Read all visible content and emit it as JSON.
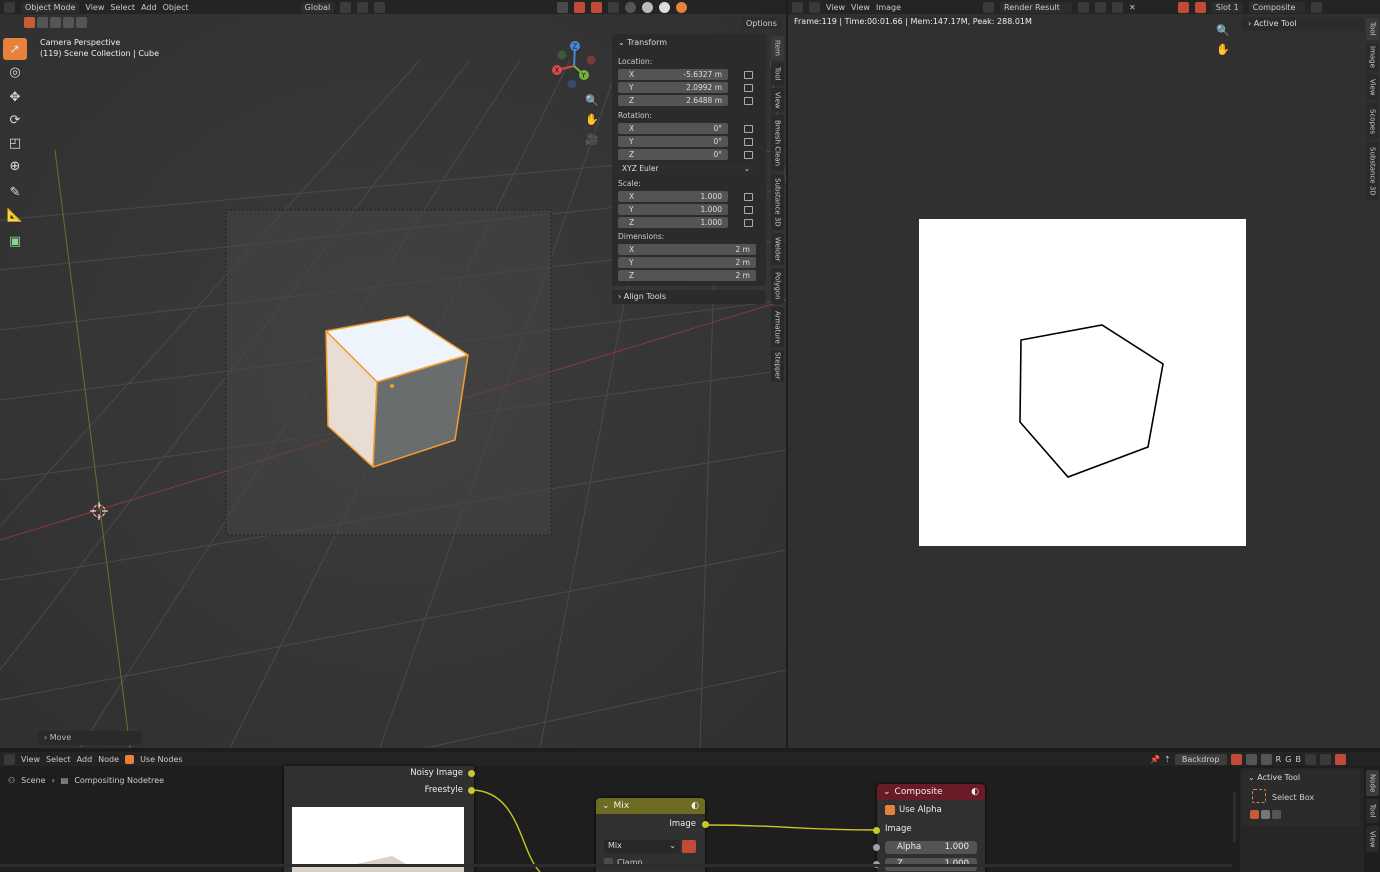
{
  "viewport": {
    "mode": "Object Mode",
    "menus": [
      "View",
      "Select",
      "Add",
      "Object"
    ],
    "transform_orientation": "Global",
    "options_label": "Options",
    "overlay_title": "Camera Perspective",
    "overlay_subtitle": "(119) Scene Collection | Cube",
    "last_op": "Move"
  },
  "npanel": {
    "transform_title": "Transform",
    "location_label": "Location:",
    "location": [
      {
        "axis": "X",
        "value": "-5.6327 m"
      },
      {
        "axis": "Y",
        "value": "2.0992 m"
      },
      {
        "axis": "Z",
        "value": "2.6488 m"
      }
    ],
    "rotation_label": "Rotation:",
    "rotation": [
      {
        "axis": "X",
        "value": "0°"
      },
      {
        "axis": "Y",
        "value": "0°"
      },
      {
        "axis": "Z",
        "value": "0°"
      }
    ],
    "rotation_mode": "XYZ Euler",
    "scale_label": "Scale:",
    "scale": [
      {
        "axis": "X",
        "value": "1.000"
      },
      {
        "axis": "Y",
        "value": "1.000"
      },
      {
        "axis": "Z",
        "value": "1.000"
      }
    ],
    "dimensions_label": "Dimensions:",
    "dimensions": [
      {
        "axis": "X",
        "value": "2 m"
      },
      {
        "axis": "Y",
        "value": "2 m"
      },
      {
        "axis": "Z",
        "value": "2 m"
      }
    ],
    "align_tools": "Align Tools",
    "tabs": [
      "Item",
      "Tool",
      "View",
      "Bmesh Clean",
      "Substance 3D",
      "Welder",
      "Polygon",
      "Armature",
      "Stepper"
    ]
  },
  "image_editor": {
    "menus": [
      "View",
      "View",
      "Image"
    ],
    "image_name": "Render Result",
    "slot": "Slot 1",
    "layer": "Composite",
    "status": "Frame:119 | Time:00:01.66 | Mem:147.17M, Peak: 288.01M",
    "active_tool": "Active Tool",
    "tabs": [
      "Tool",
      "Image",
      "View",
      "Scopes",
      "Substance 3D"
    ]
  },
  "node_editor": {
    "menus": [
      "View",
      "Select",
      "Add",
      "Node"
    ],
    "use_nodes": "Use Nodes",
    "backdrop": "Backdrop",
    "channels": [
      "R",
      "G",
      "B"
    ],
    "breadcrumb_scene": "Scene",
    "breadcrumb_tree": "Compositing Nodetree",
    "render_outputs": [
      "Noisy Image",
      "Freestyle"
    ],
    "mix_title": "Mix",
    "mix_output": "Image",
    "mix_blend": "Mix",
    "mix_clamp": "Clamp",
    "composite_title": "Composite",
    "use_alpha": "Use Alpha",
    "composite_input": "Image",
    "alpha_label": "Alpha",
    "alpha_value": "1.000",
    "z_label": "Z",
    "z_value": "1.000",
    "side_active_tool": "Active Tool",
    "select_box": "Select Box",
    "tabs": [
      "Node",
      "Tool",
      "View"
    ]
  },
  "colors": {
    "accent": "#e8823a",
    "selected_outline": "#f39c2e",
    "socket_yellow": "#c7c729",
    "socket_grey": "#a1a1a1",
    "mix_header": "#6e6b22",
    "composite_header": "#6a1c26"
  }
}
